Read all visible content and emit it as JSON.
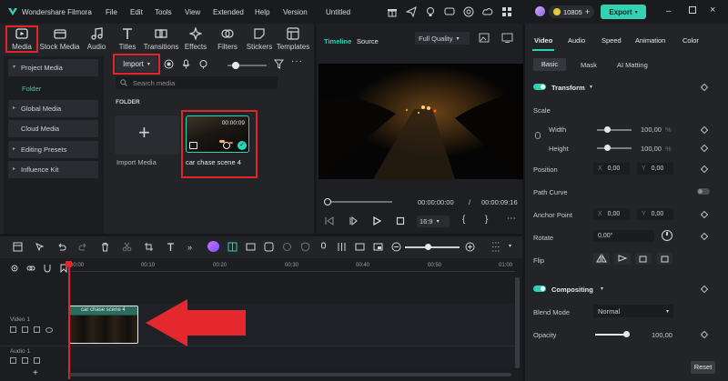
{
  "app": {
    "title": "Wondershare Filmora",
    "menu": [
      "File",
      "Edit",
      "Tools",
      "View",
      "Extended",
      "Help",
      "Version"
    ],
    "project_name": "Untitled",
    "credits": "10805",
    "export_label": "Export"
  },
  "toolbar": {
    "tabs": [
      {
        "label": "Media",
        "icon": "media-icon"
      },
      {
        "label": "Stock Media",
        "icon": "stock-media-icon"
      },
      {
        "label": "Audio",
        "icon": "audio-icon"
      },
      {
        "label": "Titles",
        "icon": "titles-icon"
      },
      {
        "label": "Transitions",
        "icon": "transitions-icon"
      },
      {
        "label": "Effects",
        "icon": "effects-icon"
      },
      {
        "label": "Filters",
        "icon": "filters-icon"
      },
      {
        "label": "Stickers",
        "icon": "stickers-icon"
      },
      {
        "label": "Templates",
        "icon": "templates-icon"
      }
    ]
  },
  "sidebar": {
    "items": [
      {
        "label": "Project Media"
      },
      {
        "label": "Folder"
      },
      {
        "label": "Global Media"
      },
      {
        "label": "Cloud Media"
      },
      {
        "label": "Editing Presets"
      },
      {
        "label": "Influence Kit"
      }
    ]
  },
  "media": {
    "import_label": "Import",
    "search_placeholder": "Search media",
    "folder_label": "FOLDER",
    "import_media_label": "Import Media",
    "clip": {
      "name": "car chase scene 4",
      "duration": "00:00:09"
    }
  },
  "preview": {
    "tabs": [
      "Timeline",
      "Source"
    ],
    "quality": "Full Quality",
    "current_time": "00:00:00:00",
    "separator": "/",
    "total_time": "00:00:09:16",
    "ratio": "16:9",
    "playhead_progress": 0.0
  },
  "properties": {
    "tabs": [
      "Video",
      "Audio",
      "Speed",
      "Animation",
      "Color"
    ],
    "subtabs": [
      "Basic",
      "Mask",
      "AI Matting"
    ],
    "transform_label": "Transform",
    "scale_label": "Scale",
    "width_label": "Width",
    "width_value": "100,00",
    "height_label": "Height",
    "height_value": "100,00",
    "unit": "%",
    "position_label": "Position",
    "position_x": "0,00",
    "position_y": "0,00",
    "path_curve_label": "Path Curve",
    "anchor_label": "Anchor Point",
    "anchor_x": "0,00",
    "anchor_y": "0,00",
    "rotate_label": "Rotate",
    "rotate_value": "0,00°",
    "flip_label": "Flip",
    "compositing_label": "Compositing",
    "blend_label": "Blend Mode",
    "blend_value": "Normal",
    "opacity_label": "Opacity",
    "opacity_value": "100,00",
    "reset_label": "Reset",
    "x_axis": "X",
    "y_axis": "Y"
  },
  "timeline": {
    "ruler": [
      "00:00",
      "00:10",
      "00:20",
      "00:30",
      "00:40",
      "00:50",
      "01:00"
    ],
    "tracks": [
      {
        "label": "Video 1"
      },
      {
        "label": "Audio 1"
      }
    ],
    "clip_label": "car chase scene 4"
  },
  "colors": {
    "accent": "#2ad3b5",
    "highlight": "#e0262b",
    "export": "#34d1b2"
  }
}
